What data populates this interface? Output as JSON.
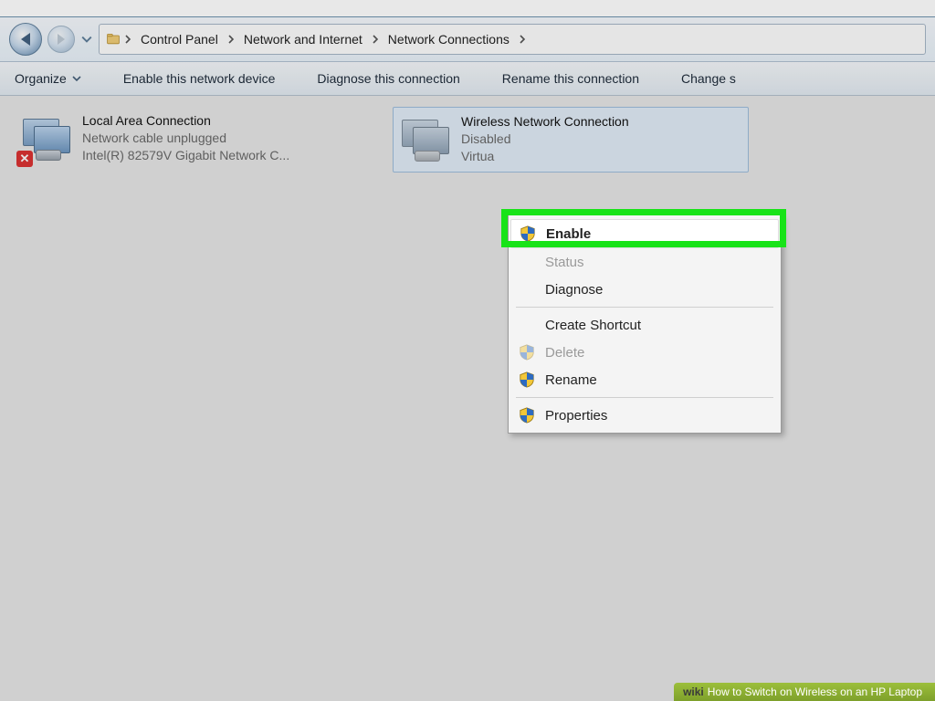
{
  "breadcrumb": {
    "items": [
      "Control Panel",
      "Network and Internet",
      "Network Connections"
    ]
  },
  "toolbar": {
    "organize": "Organize",
    "enable_device": "Enable this network device",
    "diagnose": "Diagnose this connection",
    "rename": "Rename this connection",
    "change": "Change s"
  },
  "connections": [
    {
      "title": "Local Area Connection",
      "status": "Network cable unplugged",
      "adapter": "Intel(R) 82579V Gigabit Network C...",
      "selected": false,
      "error": true
    },
    {
      "title": "Wireless Network Connection",
      "status": "Disabled",
      "adapter": "Virtua",
      "selected": true,
      "error": false
    }
  ],
  "context_menu": {
    "enable": "Enable",
    "status": "Status",
    "diagnose": "Diagnose",
    "create_shortcut": "Create Shortcut",
    "delete": "Delete",
    "rename": "Rename",
    "properties": "Properties"
  },
  "footer": {
    "prefix": "wiki",
    "text": "How to Switch on Wireless on an HP Laptop"
  }
}
